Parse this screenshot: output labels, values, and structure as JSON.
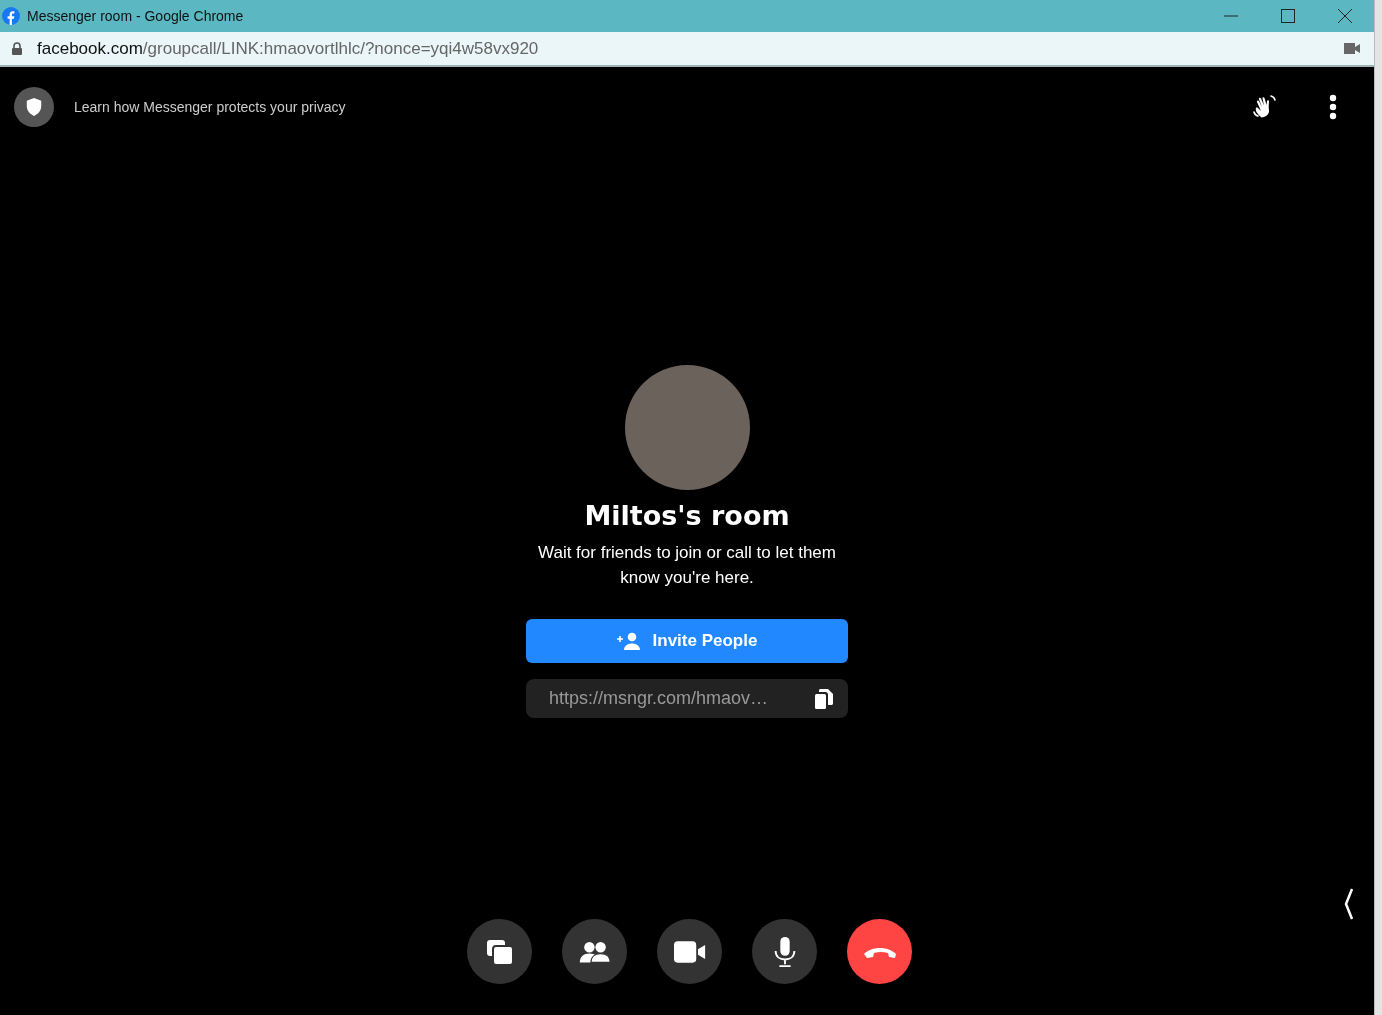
{
  "window": {
    "title": "Messenger room - Google Chrome"
  },
  "address_bar": {
    "host": "facebook.com",
    "path": "/groupcall/LINK:hmaovortlhlc/?nonce=yqi4w58vx920"
  },
  "header": {
    "privacy_link": "Learn how Messenger protects your privacy"
  },
  "room": {
    "title": "Miltos's room",
    "subtitle": "Wait for friends to join or call to let them know you're here.",
    "invite_button": "Invite People",
    "link": "https://msngr.com/hmaov…"
  },
  "call_controls": [
    {
      "kind": "screen-share"
    },
    {
      "kind": "people"
    },
    {
      "kind": "video"
    },
    {
      "kind": "microphone"
    },
    {
      "kind": "end-call"
    }
  ]
}
